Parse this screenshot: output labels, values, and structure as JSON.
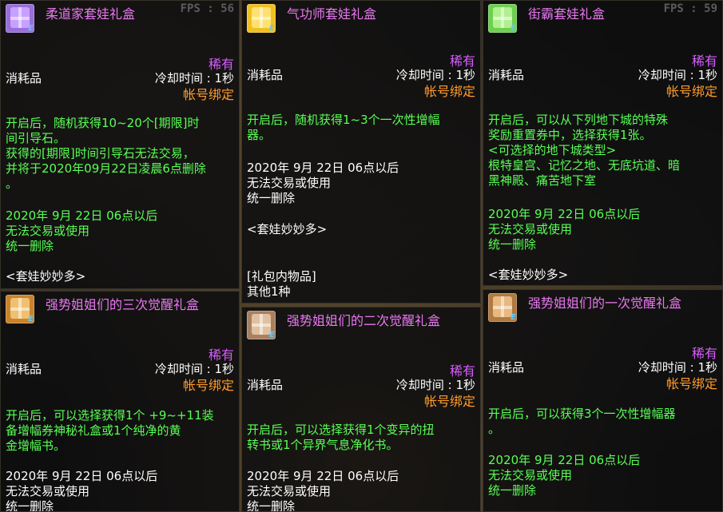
{
  "tooltips": [
    {
      "title": "柔道家套娃礼盒",
      "fps": "FPS : 56",
      "rarity": "稀有",
      "type": "消耗品",
      "cooldown": "冷却时间 : 1秒",
      "bind": "帐号绑定",
      "icon": "gift-box-purple-icon",
      "icon_color": "#9a6fd8",
      "desc": [
        "开启后，随机获得10~20个[期限]时",
        "间引导石。",
        "获得的[期限]时间引导石无法交易，",
        "并将于2020年09月22日凌晨6点删除",
        "。"
      ],
      "expire": [
        "2020年 9月 22日 06点以后",
        "无法交易或使用",
        "统一删除"
      ],
      "extra": [
        "<套娃妙妙多>"
      ]
    },
    {
      "title": "气功师套娃礼盒",
      "fps": "",
      "rarity": "稀有",
      "type": "消耗品",
      "cooldown": "冷却时间 : 1秒",
      "bind": "帐号绑定",
      "icon": "gift-box-yellow-icon",
      "icon_color": "#f0c020",
      "desc": [
        "开启后，随机获得1~3个一次性增幅",
        "器。"
      ],
      "expire": [
        "2020年 9月 22日 06点以后",
        "无法交易或使用",
        "统一删除"
      ],
      "extra": [
        "<套娃妙妙多>"
      ],
      "contents": [
        "[礼包内物品]",
        "其他1种"
      ]
    },
    {
      "title": "街霸套娃礼盒",
      "fps": "FPS : 59",
      "rarity": "稀有",
      "type": "消耗品",
      "cooldown": "冷却时间 : 1秒",
      "bind": "帐号绑定",
      "icon": "gift-box-green-icon",
      "icon_color": "#6fcf50",
      "desc": [
        "开启后，可以从下列地下城的特殊",
        "奖励重置券中，选择获得1张。",
        "<可选择的地下城类型>",
        "根特皇宫、记忆之地、无底坑道、暗",
        "黑神殿、痛苦地下室"
      ],
      "expire": [
        "2020年 9月 22日 06点以后",
        "无法交易或使用",
        "统一删除"
      ],
      "extra": [
        "<套娃妙妙多>"
      ]
    },
    {
      "title": "强势姐姐们的三次觉醒礼盒",
      "rarity": "稀有",
      "type": "消耗品",
      "cooldown": "冷却时间 : 1秒",
      "bind": "帐号绑定",
      "icon": "treasure-chest-icon",
      "icon_color": "#c8842c",
      "desc": [
        "开启后，可以选择获得1个 +9~+11装",
        "备增幅券神秘礼盒或1个纯净的黄",
        "金增幅书。"
      ],
      "expire": [
        "2020年 9月 22日 06点以后",
        "无法交易或使用",
        "统一删除"
      ]
    },
    {
      "title": "强势姐姐们的二次觉醒礼盒",
      "rarity": "稀有",
      "type": "消耗品",
      "cooldown": "冷却时间 : 1秒",
      "bind": "帐号绑定",
      "icon": "treasure-chest-icon",
      "icon_color": "#a88060",
      "desc": [
        "开启后，可以选择获得1个变异的扭",
        "转书或1个异界气息净化书。"
      ],
      "expire": [
        "2020年 9月 22日 06点以后",
        "无法交易或使用",
        "统一删除"
      ]
    },
    {
      "title": "强势姐姐们的一次觉醒礼盒",
      "rarity": "稀有",
      "type": "消耗品",
      "cooldown": "冷却时间 : 1秒",
      "bind": "帐号绑定",
      "icon": "treasure-chest-icon",
      "icon_color": "#b07a40",
      "desc": [
        "开启后，可以获得3个一次性增幅器",
        "。"
      ],
      "expire": [
        "2020年 9月 22日 06点以后",
        "无法交易或使用",
        "统一删除"
      ]
    }
  ]
}
